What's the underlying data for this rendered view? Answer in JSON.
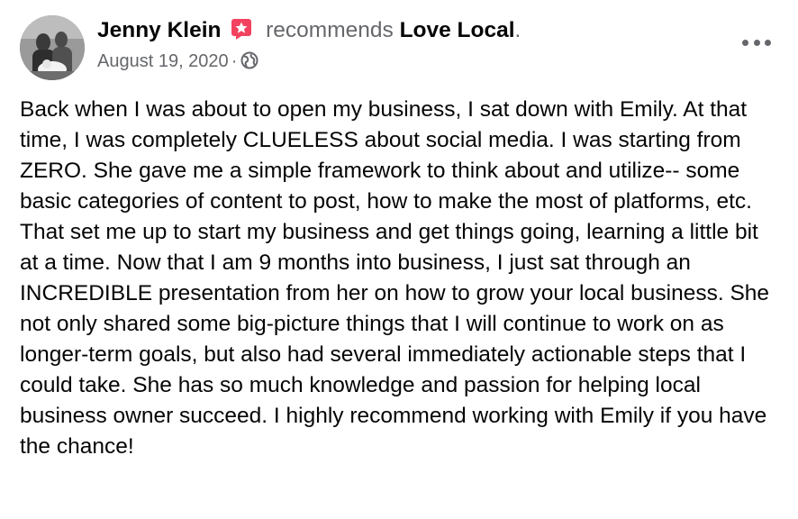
{
  "post": {
    "author": "Jenny Klein",
    "verb": "recommends",
    "page": "Love Local",
    "period": ".",
    "date": "August 19, 2020",
    "separator": "·",
    "audience_icon": "globe-icon",
    "badge_icon": "recommendation-badge-icon",
    "more_icon": "more-options-icon",
    "body": "Back when I was about to open my business, I sat down with Emily. At that time, I was completely CLUELESS about social media. I was starting from ZERO. She gave me a simple framework to think about and utilize-- some basic categories of content to post, how to make the most of platforms, etc. That set me up to start my business and get things going, learning a little bit at a time. Now that I am 9 months into business, I just sat through an INCREDIBLE presentation from her on how to grow your local business. She not only shared some big-picture things that I will continue to work on as longer-term goals, but also had several immediately actionable steps that I could take. She has so much knowledge and passion for helping local business owner succeed. I highly recommend working with Emily if you have the chance!"
  },
  "colors": {
    "primary_text": "#050505",
    "secondary_text": "#65676b",
    "badge": "#f3425f"
  }
}
